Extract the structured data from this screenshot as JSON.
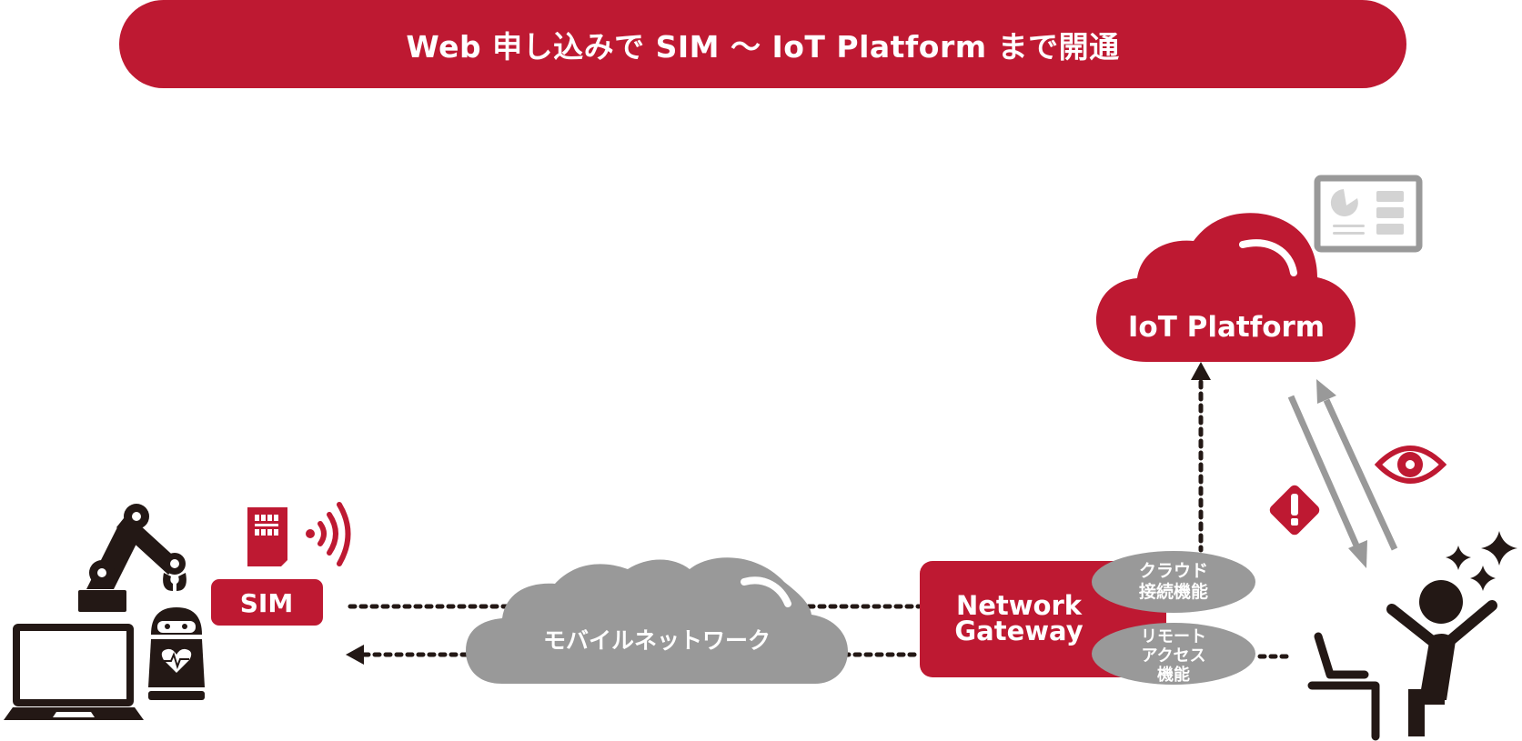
{
  "header": {
    "title": "Web 申し込みで SIM ～ IoT Platform まで開通"
  },
  "colors": {
    "brand_red": "#be1932",
    "gray": "#999999",
    "light_gray": "#d3d3d3",
    "ink": "#231815",
    "white": "#ffffff"
  },
  "nodes": {
    "devices": {
      "icons": [
        "laptop-icon",
        "robot-arm-icon",
        "health-robot-icon"
      ]
    },
    "sim": {
      "label": "SIM",
      "icons": [
        "sim-card-icon",
        "wireless-signal-icon"
      ]
    },
    "mobile_network": {
      "label": "モバイルネットワーク"
    },
    "gateway": {
      "label_line1": "Network",
      "label_line2": "Gateway",
      "features": [
        {
          "line1": "クラウド",
          "line2": "接続機能"
        },
        {
          "line1": "リモート",
          "line2": "アクセス",
          "line3": "機能"
        }
      ]
    },
    "iot_platform": {
      "label": "IoT Platform",
      "icons": [
        "dashboard-icon"
      ]
    },
    "user": {
      "icons": [
        "alert-icon",
        "eye-icon",
        "sparkle-icon",
        "happy-user-at-laptop-icon"
      ]
    }
  },
  "connections": [
    {
      "from": "sim",
      "to": "gateway",
      "style": "dotted"
    },
    {
      "from": "gateway",
      "to": "devices",
      "style": "dotted-arrow"
    },
    {
      "from": "gateway",
      "to": "iot_platform",
      "style": "dotted-arrow"
    },
    {
      "from": "iot_platform",
      "to": "user",
      "style": "gray-arrow"
    },
    {
      "from": "user",
      "to": "iot_platform",
      "style": "gray-arrow"
    },
    {
      "from": "user",
      "to": "gateway",
      "style": "dotted"
    }
  ]
}
